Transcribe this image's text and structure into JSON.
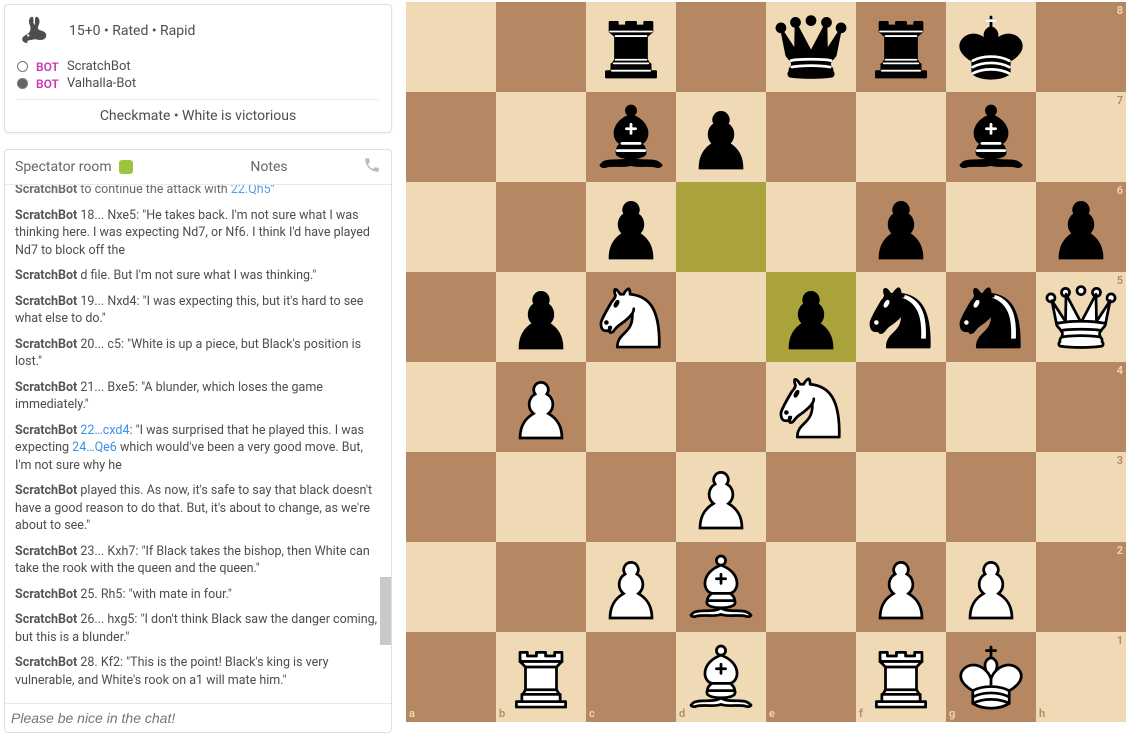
{
  "info": {
    "title": "15+0 • Rated • Rapid",
    "white_bot": "BOT",
    "white_name": "ScratchBot",
    "black_bot": "BOT",
    "black_name": "Valhalla-Bot",
    "result": "Checkmate • White is victorious"
  },
  "tabs": {
    "room": "Spectator room",
    "notes": "Notes"
  },
  "chat": {
    "placeholder": "Please be nice in the chat!",
    "messages": [
      {
        "author": "ScratchBot",
        "text": " to continue the attack with ",
        "link": "22.Qh5",
        "tail": "\"",
        "cut": true
      },
      {
        "author": "ScratchBot",
        "text": " 18... Nxe5: \"He takes back. I'm not sure what I was thinking here. I was expecting Nd7, or Nf6. I think I'd have played Nd7 to block off the"
      },
      {
        "author": "ScratchBot",
        "text": " d file. But I'm not sure what I was thinking.\""
      },
      {
        "author": "ScratchBot",
        "text": " 19... Nxd4: \"I was expecting this, but it's hard to see what else to do.\""
      },
      {
        "author": "ScratchBot",
        "text": " 20... c5: \"White is up a piece, but Black's position is lost.\""
      },
      {
        "author": "ScratchBot",
        "text": " 21... Bxe5: \"A blunder, which loses the game immediately.\""
      },
      {
        "author": "ScratchBot",
        "link1": "22…cxd4",
        "mid": ": \"I was surprised that he played this. I was expecting ",
        "link2": "24…Qe6",
        "tail": " which would've been a very good move. But, I'm not sure why he"
      },
      {
        "author": "ScratchBot",
        "text": " played this. As now, it's safe to say that black doesn't have a good reason to do that. But, it's about to change, as we're about to see.\""
      },
      {
        "author": "ScratchBot",
        "text": " 23... Kxh7: \"If Black takes the bishop, then White can take the rook with the queen and the queen.\""
      },
      {
        "author": "ScratchBot",
        "text": " 25. Rh5: \"with mate in four.\""
      },
      {
        "author": "ScratchBot",
        "text": " 26... hxg5: \"I don't think Black saw the danger coming, but this is a blunder.\""
      },
      {
        "author": "ScratchBot",
        "text": " 28. Kf2: \"This is the point! Black's king is very vulnerable, and White's rook on a1 will mate him.\""
      }
    ]
  },
  "board": {
    "highlights": [
      "d6",
      "e5"
    ],
    "position": [
      {
        "sq": "c8",
        "p": "r",
        "c": "b"
      },
      {
        "sq": "e8",
        "p": "q",
        "c": "b"
      },
      {
        "sq": "f8",
        "p": "r",
        "c": "b"
      },
      {
        "sq": "g8",
        "p": "k",
        "c": "b"
      },
      {
        "sq": "c7",
        "p": "b",
        "c": "b"
      },
      {
        "sq": "d7",
        "p": "p",
        "c": "b"
      },
      {
        "sq": "g7",
        "p": "b",
        "c": "b"
      },
      {
        "sq": "c6",
        "p": "p",
        "c": "b"
      },
      {
        "sq": "f6",
        "p": "p",
        "c": "b"
      },
      {
        "sq": "h6",
        "p": "p",
        "c": "b"
      },
      {
        "sq": "b5",
        "p": "p",
        "c": "b"
      },
      {
        "sq": "c5",
        "p": "n",
        "c": "w"
      },
      {
        "sq": "e5",
        "p": "p",
        "c": "b"
      },
      {
        "sq": "f5",
        "p": "n",
        "c": "b"
      },
      {
        "sq": "g5",
        "p": "n",
        "c": "b"
      },
      {
        "sq": "h5",
        "p": "q",
        "c": "w"
      },
      {
        "sq": "b4",
        "p": "p",
        "c": "w"
      },
      {
        "sq": "e4",
        "p": "n",
        "c": "w"
      },
      {
        "sq": "d3",
        "p": "p",
        "c": "w"
      },
      {
        "sq": "c2",
        "p": "p",
        "c": "w"
      },
      {
        "sq": "d2",
        "p": "b",
        "c": "w"
      },
      {
        "sq": "f2",
        "p": "p",
        "c": "w"
      },
      {
        "sq": "g2",
        "p": "p",
        "c": "w"
      },
      {
        "sq": "b1",
        "p": "r",
        "c": "w"
      },
      {
        "sq": "d1",
        "p": "b",
        "c": "w"
      },
      {
        "sq": "f1",
        "p": "r",
        "c": "w"
      },
      {
        "sq": "g1",
        "p": "k",
        "c": "w"
      }
    ],
    "files": [
      "a",
      "b",
      "c",
      "d",
      "e",
      "f",
      "g",
      "h"
    ],
    "ranks": [
      "8",
      "7",
      "6",
      "5",
      "4",
      "3",
      "2",
      "1"
    ]
  }
}
